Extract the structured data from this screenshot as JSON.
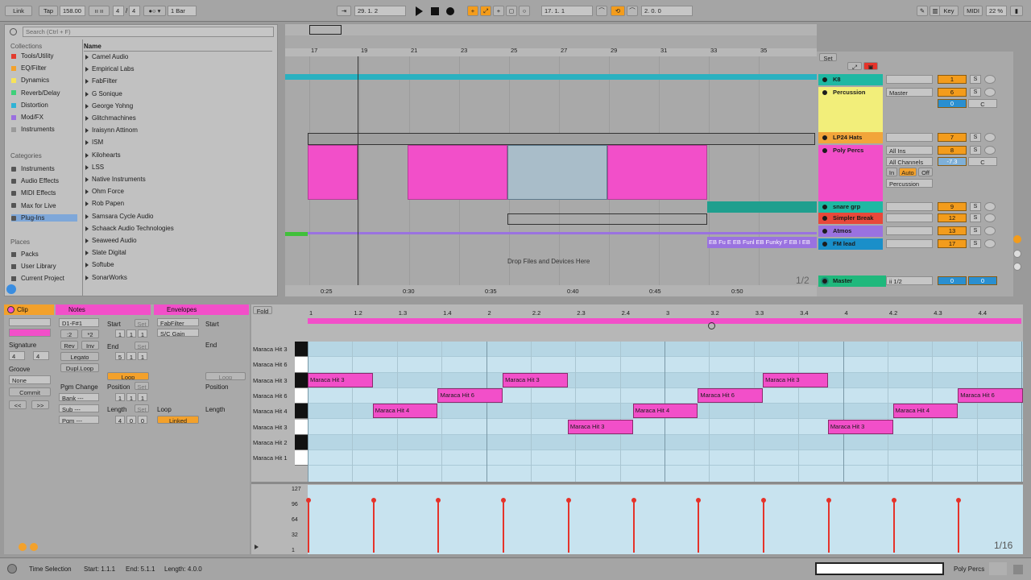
{
  "transport": {
    "link": "Link",
    "tap": "Tap",
    "tempo": "158.00",
    "sig_num": "4",
    "sig_den": "4",
    "metro": "1 Bar",
    "position": "29.  1.  2",
    "loop_start": "17.  1.  1",
    "loop_len": "2.  0.  0",
    "key": "Key",
    "midi": "MIDI",
    "cpu": "22 %"
  },
  "browser": {
    "search_placeholder": "Search (Ctrl + F)",
    "collections_header": "Collections",
    "collections": [
      {
        "label": "Tools/Utility",
        "color": "#e33b2e"
      },
      {
        "label": "EQ/Filter",
        "color": "#f3a12b"
      },
      {
        "label": "Dynamics",
        "color": "#f7e35a"
      },
      {
        "label": "Reverb/Delay",
        "color": "#3fd07a"
      },
      {
        "label": "Distortion",
        "color": "#2fb3d6"
      },
      {
        "label": "Mod/FX",
        "color": "#9a6fe0"
      },
      {
        "label": "Instruments",
        "color": "#9a9a9a"
      }
    ],
    "categories_header": "Categories",
    "categories": [
      "Instruments",
      "Audio Effects",
      "MIDI Effects",
      "Max for Live",
      "Plug-Ins"
    ],
    "places_header": "Places",
    "places": [
      "Packs",
      "User Library",
      "Current Project"
    ],
    "name_col": "Name",
    "folders": [
      "Camel Audio",
      "Empirical Labs",
      "FabFilter",
      "G Sonique",
      "George Yohng",
      "Glitchmachines",
      "Iraisynn Attinom",
      "ISM",
      "Kilohearts",
      "LSS",
      "Native Instruments",
      "Ohm Force",
      "Rob Papen",
      "Samsara Cycle Audio",
      "Schaack Audio Technologies",
      "Seaweed Audio",
      "Slate Digital",
      "Softube",
      "SonarWorks"
    ]
  },
  "arrangement": {
    "bars": [
      "17",
      "19",
      "21",
      "23",
      "25",
      "27",
      "29",
      "31",
      "33",
      "35"
    ],
    "times": [
      "0:25",
      "0:30",
      "0:35",
      "0:40",
      "0:45",
      "0:50"
    ],
    "drop_text": "Drop Files and Devices Here",
    "page": "1/2",
    "clip_labels": [
      "EB Fu",
      "E",
      "EB Funl",
      "EB Funky F",
      "EB I",
      "EB"
    ]
  },
  "mixer": {
    "set": "Set",
    "tracks": [
      {
        "name": "K8",
        "num": "1",
        "color": "#1fb8a3"
      },
      {
        "name": "Percussion",
        "num": "6",
        "color": "#f2ee7a",
        "route": "Master",
        "vol": "0",
        "pan": "C"
      },
      {
        "name": "LP24 Hats",
        "num": "7",
        "color": "#f2a53a"
      },
      {
        "name": "Poly Percs",
        "num": "8",
        "color": "#f24fc9",
        "input": "All Ins",
        "channel": "All Channels",
        "mon_in": "In",
        "mon_auto": "Auto",
        "mon_off": "Off",
        "out": "Percussion",
        "vol": "-7.3",
        "pan": "C"
      },
      {
        "name": "snare grp",
        "num": "9",
        "color": "#1fb8a3"
      },
      {
        "name": "Simpler Break",
        "num": "12",
        "color": "#e8483a"
      },
      {
        "name": "Atmos",
        "num": "13",
        "color": "#9a72e0"
      },
      {
        "name": "FM lead",
        "num": "17",
        "color": "#1a8fc9"
      }
    ],
    "master": "Master",
    "master_route": "ii 1/2",
    "master_vol": "0",
    "master_pan": "0"
  },
  "clip": {
    "title": "Clip",
    "signature_label": "Signature",
    "sig_num": "4",
    "sig_den": "4",
    "groove_label": "Groove",
    "groove_val": "None",
    "commit": "Commit",
    "notes_title": "Notes",
    "range": "D1-F#1",
    "div2": ":2",
    "mul2": "*2",
    "rev": "Rev",
    "inv": "Inv",
    "legato": "Legato",
    "dupl": "Dupl.Loop",
    "start_label": "Start",
    "start_val": [
      "1",
      "1",
      "1"
    ],
    "end_label": "End",
    "end_val": [
      "5",
      "1",
      "1"
    ],
    "loop": "Loop",
    "position_label": "Position",
    "position_val": [
      "1",
      "1",
      "1"
    ],
    "length_label": "Length",
    "length_val": [
      "4",
      "0",
      "0"
    ],
    "set": "Set",
    "pgm_change": "Pgm Change",
    "bank": "Bank ---",
    "sub": "Sub ---",
    "pgm": "Pgm ---",
    "env_title": "Envelopes",
    "env_dev": "FabFilter",
    "env_param": "S/C Gain",
    "env_start": "Start",
    "env_end": "End",
    "env_loop_btn": "Loop",
    "env_position": "Position",
    "env_loop": "Loop",
    "env_length": "Length",
    "linked": "Linked"
  },
  "piano": {
    "fold": "Fold",
    "ruler": [
      "1",
      "1.2",
      "1.3",
      "1.4",
      "2",
      "2.2",
      "2.3",
      "2.4",
      "3",
      "3.2",
      "3.3",
      "3.4",
      "4",
      "4.2",
      "4.3",
      "4.4"
    ],
    "keys": [
      "Maraca Hit 3",
      "Maraca Hit 6",
      "Maraca Hit 3",
      "Maraca Hit 6",
      "Maraca Hit 4",
      "Maraca Hit 3",
      "Maraca Hit 2",
      "Maraca Hit 1"
    ],
    "notes": [
      {
        "label": "Maraca Hit 3",
        "row": 2,
        "start": 0,
        "len": 1
      },
      {
        "label": "Maraca Hit 4",
        "row": 4,
        "start": 1,
        "len": 1
      },
      {
        "label": "Maraca Hit 6",
        "row": 3,
        "start": 2,
        "len": 1
      },
      {
        "label": "Maraca Hit 3",
        "row": 2,
        "start": 3,
        "len": 1
      },
      {
        "label": "Maraca Hit 3",
        "row": 5,
        "start": 4,
        "len": 1
      },
      {
        "label": "Maraca Hit 4",
        "row": 4,
        "start": 5,
        "len": 1
      },
      {
        "label": "Maraca Hit 6",
        "row": 3,
        "start": 6,
        "len": 1
      },
      {
        "label": "Maraca Hit 3",
        "row": 2,
        "start": 7,
        "len": 1
      },
      {
        "label": "Maraca Hit 3",
        "row": 5,
        "start": 8,
        "len": 1
      },
      {
        "label": "Maraca Hit 4",
        "row": 4,
        "start": 9,
        "len": 1
      },
      {
        "label": "Maraca Hit 6",
        "row": 3,
        "start": 10,
        "len": 1
      }
    ],
    "vel_labels": [
      "127",
      "96",
      "64",
      "32",
      "1"
    ],
    "velocities": [
      100,
      100,
      100,
      100,
      100,
      100,
      100,
      100,
      100,
      100,
      100
    ],
    "grid": "1/16"
  },
  "status": {
    "time_selection": "Time Selection",
    "start": "Start: 1.1.1",
    "end": "End: 5.1.1",
    "length": "Length: 4.0.0",
    "track": "Poly Percs"
  }
}
